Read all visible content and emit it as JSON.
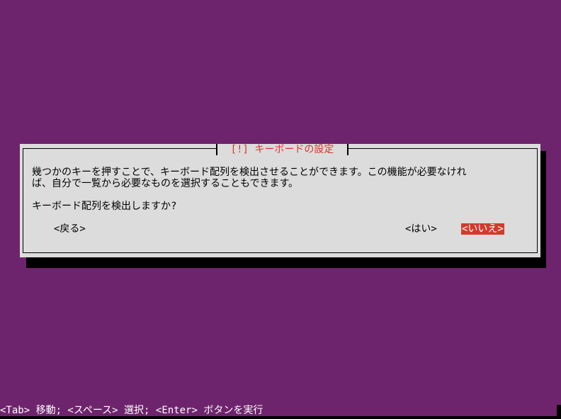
{
  "dialog": {
    "title": "[!] キーボードの設定",
    "description_line_1": "幾つかのキーを押すことで、キーボード配列を検出させることができます。この機能が必要なけれ",
    "description_line_2": "ば、自分で一覧から必要なものを選択することもできます。",
    "question": "キーボード配列を検出しますか?",
    "buttons": {
      "back": "<戻る>",
      "yes": "<はい>",
      "no": "<いいえ>"
    }
  },
  "status_bar": {
    "text": "<Tab> 移動; <スペース> 選択; <Enter> ボタンを実行"
  },
  "colors": {
    "background": "#6e246c",
    "dialog_background": "#dcdcdc",
    "accent_red": "#d23a2c",
    "shadow": "#000000"
  }
}
